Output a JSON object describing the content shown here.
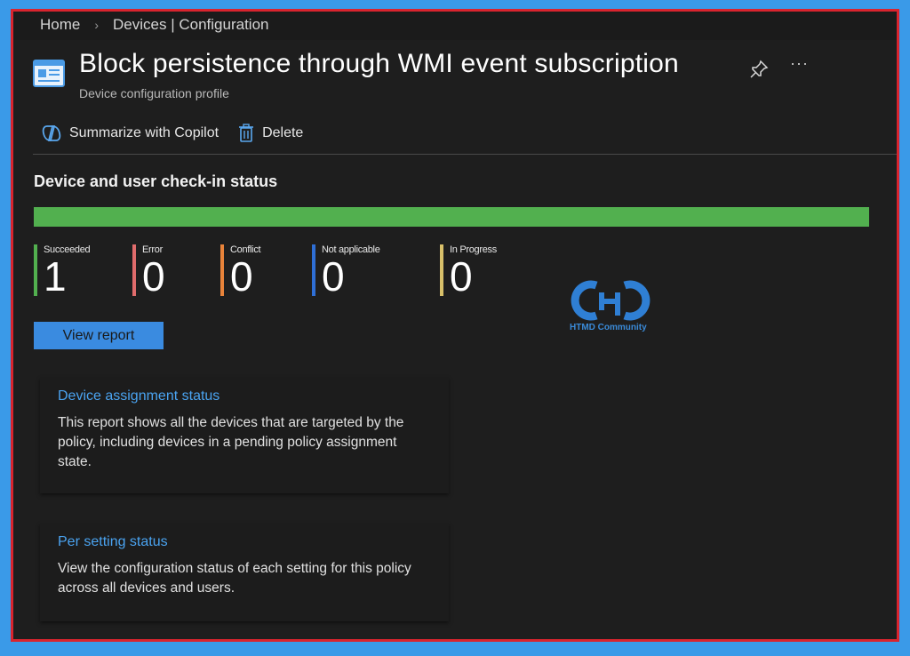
{
  "breadcrumb": {
    "home": "Home",
    "current": "Devices | Configuration"
  },
  "header": {
    "title": "Block persistence through WMI event subscription",
    "subtitle": "Device configuration profile",
    "more_label": "···"
  },
  "commands": {
    "copilot": "Summarize with Copilot",
    "delete": "Delete"
  },
  "checkin": {
    "title": "Device and user check-in status",
    "progress": 1.0,
    "counts": [
      {
        "label": "Succeeded",
        "value": "1",
        "color": "#52b04f"
      },
      {
        "label": "Error",
        "value": "0",
        "color": "#e06c6c"
      },
      {
        "label": "Conflict",
        "value": "0",
        "color": "#e8833a"
      },
      {
        "label": "Not applicable",
        "value": "0",
        "color": "#2f6fd6"
      },
      {
        "label": "In Progress",
        "value": "0",
        "color": "#d8c06a"
      }
    ],
    "view_report": "View report"
  },
  "watermark": {
    "text": "HTMD Community"
  },
  "cards": [
    {
      "title": "Device assignment status",
      "description": "This report shows all the devices that are targeted by the policy, including devices in a pending policy assignment state."
    },
    {
      "title": "Per setting status",
      "description": "View the configuration status of each setting for this policy across all devices and users."
    }
  ],
  "colors": {
    "accent": "#3a8be0",
    "link": "#4aa3f0",
    "frame": "#d9242e",
    "background": "#1e1e1e"
  }
}
